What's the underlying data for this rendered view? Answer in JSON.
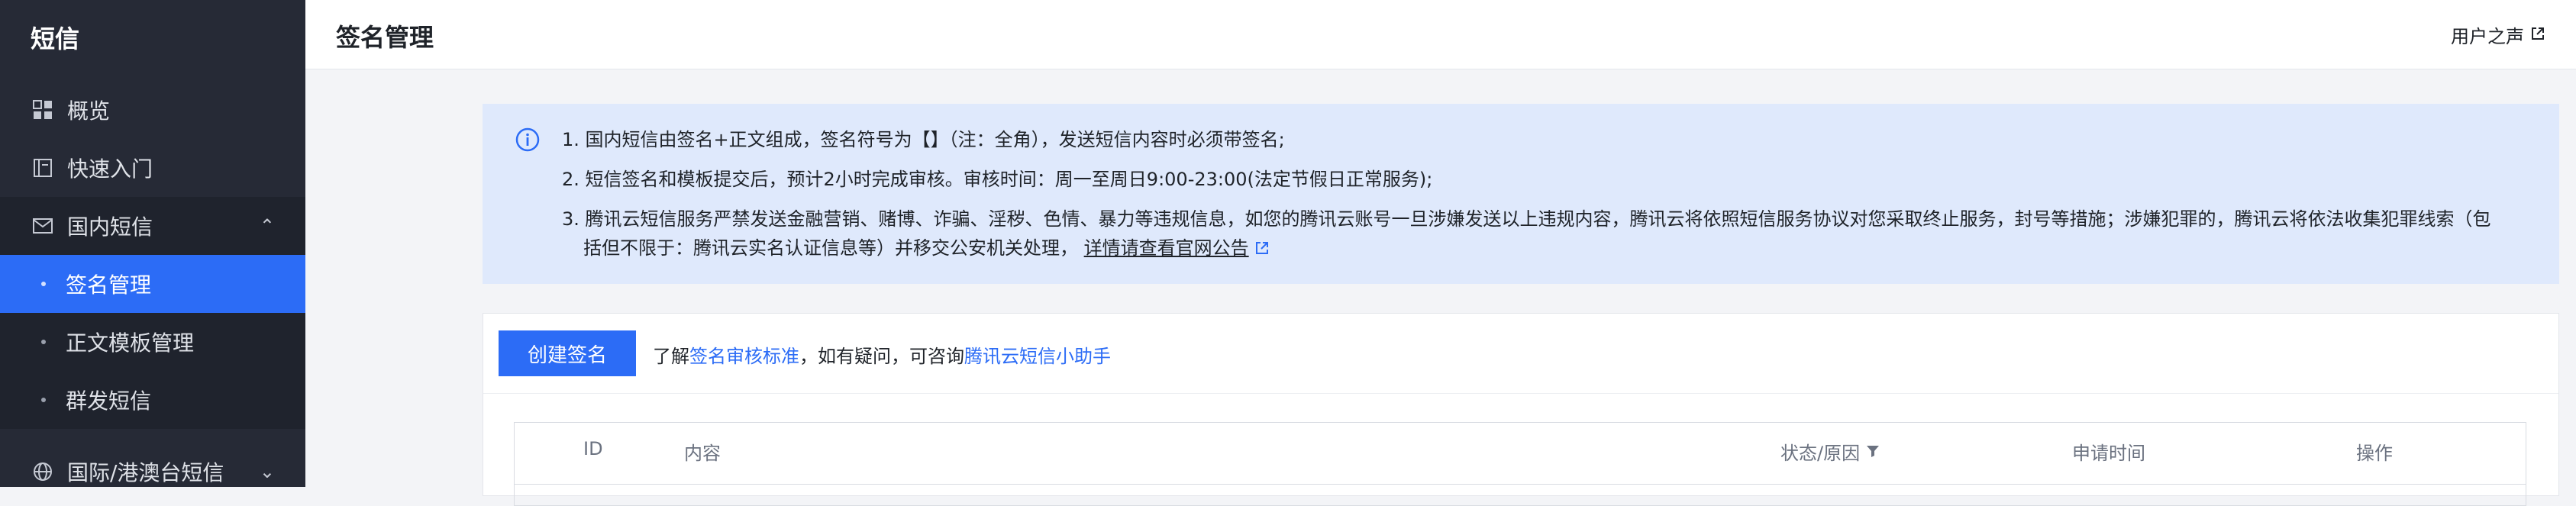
{
  "sidebar": {
    "title": "短信",
    "items": [
      {
        "label": "概览",
        "icon": "dashboard-grid-icon"
      },
      {
        "label": "快速入门",
        "icon": "book-icon"
      },
      {
        "label": "国内短信",
        "icon": "mail-icon",
        "expanded": true,
        "children": [
          {
            "label": "签名管理",
            "active": true
          },
          {
            "label": "正文模板管理"
          },
          {
            "label": "群发短信"
          }
        ]
      },
      {
        "label": "国际/港澳台短信",
        "icon": "globe-icon",
        "expanded": false
      }
    ]
  },
  "header": {
    "title": "签名管理",
    "feedback": "用户之声"
  },
  "notice": {
    "lines": [
      "1. 国内短信由签名+正文组成，签名符号为【】（注：全角），发送短信内容时必须带签名;",
      "2. 短信签名和模板提交后，预计2小时完成审核。审核时间：周一至周日9:00-23:00(法定节假日正常服务);",
      "3. 腾讯云短信服务严禁发送金融营销、赌博、诈骗、淫秽、色情、暴力等违规信息，如您的腾讯云账号一旦涉嫌发送以上违规内容，腾讯云将依照短信服务协议对您采取终止服务，封号等措施；涉嫌犯罪的，腾讯云将依法收集犯罪线索（包",
      "括但不限于：腾讯云实名认证信息等）并移交公安机关处理，"
    ],
    "link": "详情请查看官网公告"
  },
  "toolbar": {
    "create_label": "创建签名",
    "hint_prefix": "了解",
    "hint_link1": "签名审核标准",
    "hint_mid": "，如有疑问，可咨询",
    "hint_link2": "腾讯云短信小助手"
  },
  "table": {
    "columns": [
      "ID",
      "内容",
      "状态/原因",
      "申请时间",
      "操作"
    ]
  },
  "colors": {
    "sidebar_bg": "#262a36",
    "accent": "#2c6cf6",
    "notice_bg": "#dfe9fc"
  }
}
